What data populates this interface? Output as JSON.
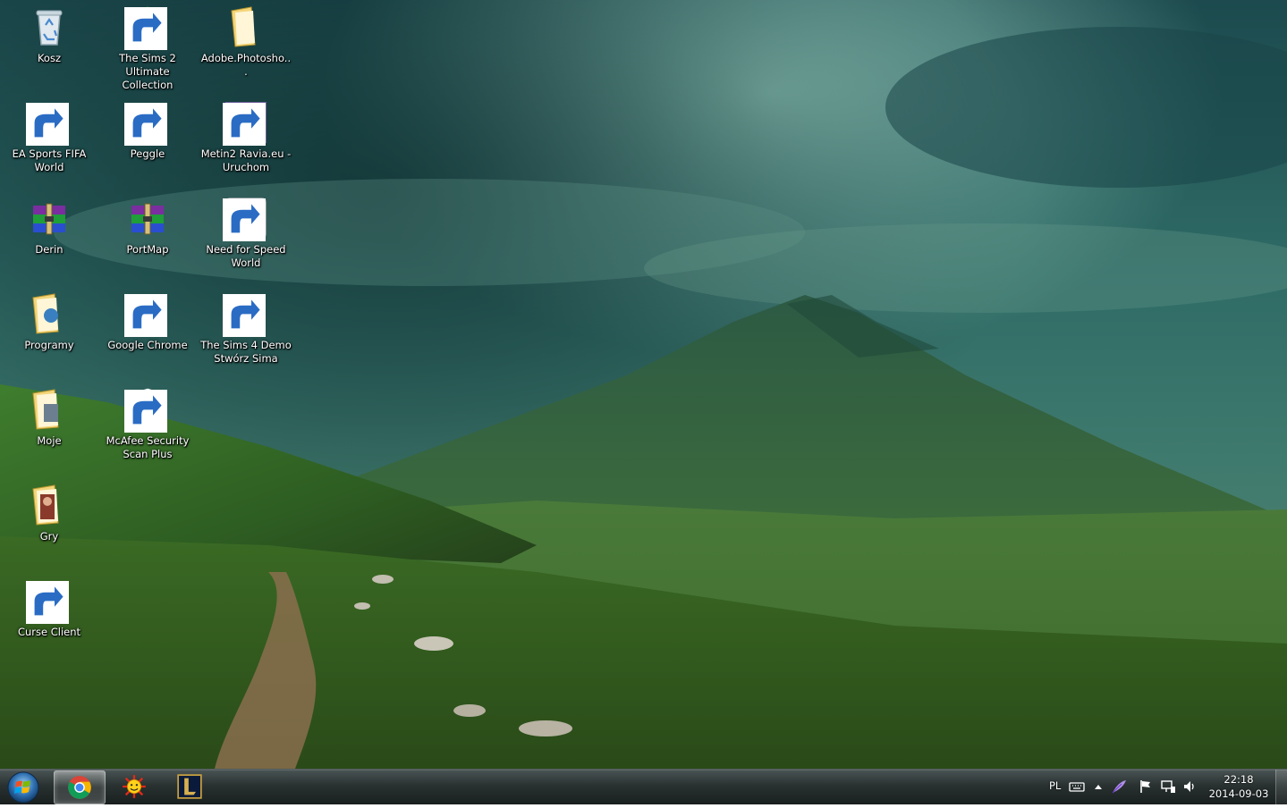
{
  "desktop": {
    "icons": [
      {
        "label": "Kosz",
        "icon": "recycle-bin-icon"
      },
      {
        "label": "The Sims 2 Ultimate Collection",
        "icon": "sims2-plumbob-icon"
      },
      {
        "label": "Adobe.Photosho...",
        "icon": "folder-icon"
      },
      {
        "label": "EA Sports FIFA World",
        "icon": "fifa-world-icon"
      },
      {
        "label": "Peggle",
        "icon": "peggle-icon"
      },
      {
        "label": "Metin2 Ravia.eu - Uruchom",
        "icon": "metin2-icon"
      },
      {
        "label": "Derin",
        "icon": "winrar-archive-icon"
      },
      {
        "label": "PortMap",
        "icon": "winrar-archive-icon"
      },
      {
        "label": "Need for Speed World",
        "icon": "nfs-world-icon"
      },
      {
        "label": "Programy",
        "icon": "folder-icon"
      },
      {
        "label": "Google Chrome",
        "icon": "chrome-icon"
      },
      {
        "label": "The Sims 4 Demo Stwórz Sima",
        "icon": "sims4-demo-icon"
      },
      {
        "label": "Moje",
        "icon": "folder-icon"
      },
      {
        "label": "McAfee Security Scan Plus",
        "icon": "mcafee-icon"
      },
      {
        "label": "Gry",
        "icon": "folder-icon"
      },
      {
        "label": "Curse Client",
        "icon": "curse-client-icon"
      }
    ]
  },
  "taskbar": {
    "start": {
      "icon": "windows-start-orb-icon"
    },
    "pinned": [
      {
        "icon": "chrome-icon",
        "active": true
      },
      {
        "icon": "sun-smiley-icon",
        "active": false
      },
      {
        "icon": "league-of-legends-icon",
        "active": false
      }
    ],
    "tray": {
      "language": "PL",
      "icons": [
        "keyboard-icon",
        "show-hidden-icons-arrow-icon",
        "feather-icon",
        "action-center-flag-icon",
        "network-icon",
        "volume-icon"
      ],
      "time": "22:18",
      "date": "2014-09-03"
    }
  }
}
